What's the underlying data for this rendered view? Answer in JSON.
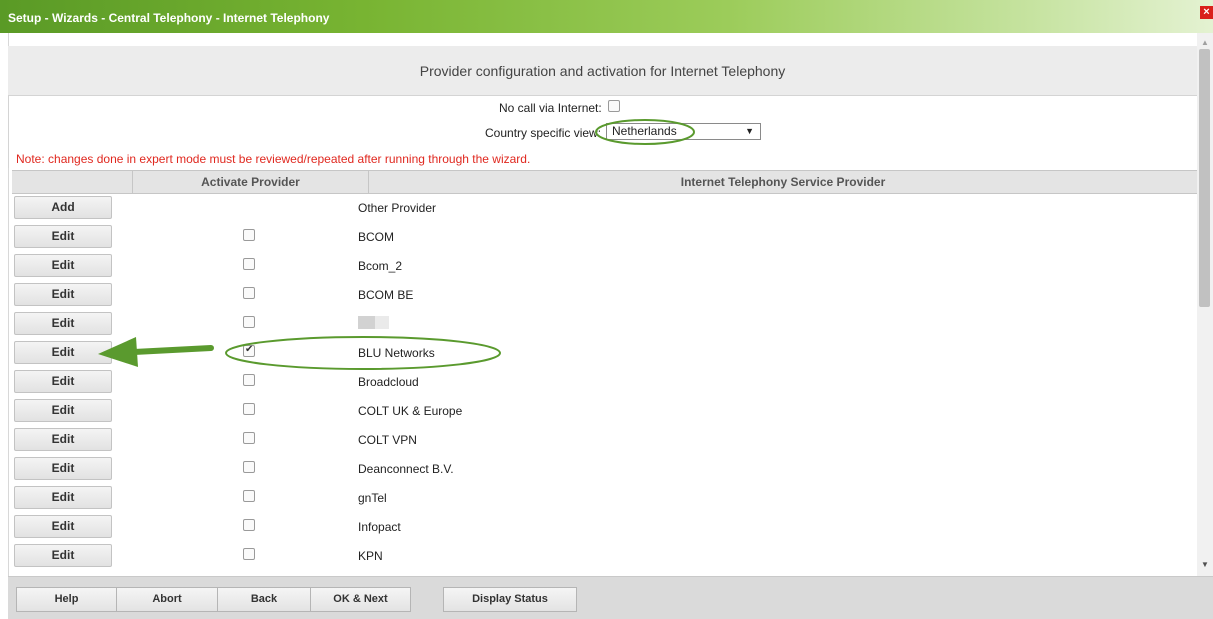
{
  "window": {
    "title": "Setup - Wizards - Central Telephony - Internet Telephony",
    "close_glyph": "×"
  },
  "page": {
    "heading": "Provider configuration and activation for Internet Telephony",
    "no_call_label": "No call via Internet:",
    "no_call_checked": false,
    "country_label": "Country specific view:",
    "country_value": "Netherlands",
    "note": "Note: changes done in expert mode must be reviewed/repeated after running through the wizard."
  },
  "table": {
    "col_activate": "Activate Provider",
    "col_provider": "Internet Telephony Service Provider",
    "rows": [
      {
        "button": "Add",
        "provider": "Other Provider",
        "has_checkbox": false,
        "checked": false
      },
      {
        "button": "Edit",
        "provider": "BCOM",
        "has_checkbox": true,
        "checked": false
      },
      {
        "button": "Edit",
        "provider": "Bcom_2",
        "has_checkbox": true,
        "checked": false
      },
      {
        "button": "Edit",
        "provider": "BCOM BE",
        "has_checkbox": true,
        "checked": false
      },
      {
        "button": "Edit",
        "provider": "",
        "has_checkbox": true,
        "checked": false,
        "redacted": true
      },
      {
        "button": "Edit",
        "provider": "BLU Networks",
        "has_checkbox": true,
        "checked": true
      },
      {
        "button": "Edit",
        "provider": "Broadcloud",
        "has_checkbox": true,
        "checked": false
      },
      {
        "button": "Edit",
        "provider": "COLT UK & Europe",
        "has_checkbox": true,
        "checked": false
      },
      {
        "button": "Edit",
        "provider": "COLT VPN",
        "has_checkbox": true,
        "checked": false
      },
      {
        "button": "Edit",
        "provider": "Deanconnect B.V.",
        "has_checkbox": true,
        "checked": false
      },
      {
        "button": "Edit",
        "provider": "gnTel",
        "has_checkbox": true,
        "checked": false
      },
      {
        "button": "Edit",
        "provider": "Infopact",
        "has_checkbox": true,
        "checked": false
      },
      {
        "button": "Edit",
        "provider": "KPN",
        "has_checkbox": true,
        "checked": false
      }
    ]
  },
  "footer": {
    "help": "Help",
    "abort": "Abort",
    "back": "Back",
    "ok_next": "OK & Next",
    "display_status": "Display Status"
  },
  "colors": {
    "title_bar_green": "#78b432",
    "annotation_green": "#5a9a2e",
    "note_red": "#e0281f"
  },
  "icons": {
    "close": "close-icon",
    "scroll_up": "scroll-up-icon",
    "scroll_down": "scroll-down-icon",
    "dropdown": "chevron-down-icon",
    "annotation_arrow": "arrow-left-icon"
  }
}
